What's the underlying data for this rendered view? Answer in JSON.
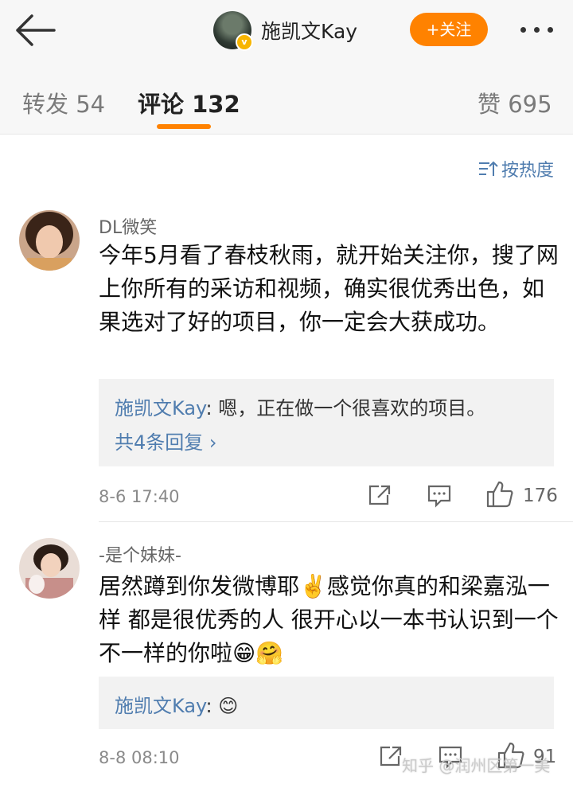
{
  "header": {
    "username": "施凯文Kay",
    "follow_label": "+关注"
  },
  "tabs": {
    "repost": "转发 54",
    "comments": "评论 132",
    "likes": "赞 695"
  },
  "sort_label": "按热度",
  "comments": [
    {
      "name": "DL微笑",
      "text": "今年5月看了春枝秋雨，就开始关注你，搜了网上你所有的采访和视频，确实很优秀出色，如果选对了好的项目，你一定会大获成功。",
      "reply_name": "施凯文Kay",
      "reply_text": ": 嗯，正在做一个很喜欢的项目。",
      "more_replies": "共4条回复 ›",
      "time": "8-6 17:40",
      "likes": "176"
    },
    {
      "name": "-是个妹妹-",
      "text": "居然蹲到你发微博耶✌️感觉你真的和梁嘉泓一样 都是很优秀的人 很开心以一本书认识到一个不一样的你啦😁🤗",
      "reply_name": "施凯文Kay",
      "reply_text": ": 😊",
      "time": "8-8 08:10",
      "likes": "91"
    }
  ],
  "watermark": "知乎 @润州区第一美",
  "colors": {
    "accent": "#ff8200",
    "link": "#507daf"
  }
}
